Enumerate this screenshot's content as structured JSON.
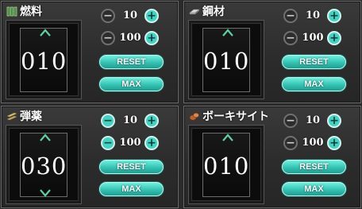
{
  "panels": [
    {
      "name": "燃料",
      "value": "010",
      "icon": "fuel-icon",
      "can_increase": true,
      "can_decrease": false,
      "step_small": "10",
      "step_large": "100",
      "reset_label": "RESET",
      "max_label": "MAX"
    },
    {
      "name": "鋼材",
      "value": "010",
      "icon": "steel-icon",
      "can_increase": true,
      "can_decrease": false,
      "step_small": "10",
      "step_large": "100",
      "reset_label": "RESET",
      "max_label": "MAX"
    },
    {
      "name": "弾薬",
      "value": "030",
      "icon": "ammo-icon",
      "can_increase": true,
      "can_decrease": true,
      "step_small": "10",
      "step_large": "100",
      "reset_label": "RESET",
      "max_label": "MAX"
    },
    {
      "name": "ボーキサイト",
      "value": "010",
      "icon": "bauxite-icon",
      "can_increase": true,
      "can_decrease": false,
      "step_small": "10",
      "step_large": "100",
      "reset_label": "RESET",
      "max_label": "MAX"
    }
  ],
  "icons": {
    "minus": "−",
    "plus": "+"
  },
  "colors": {
    "accent": "#3fd4c4",
    "panel_bg": "#2c2c2c",
    "arrow": "#5fcfa0"
  }
}
